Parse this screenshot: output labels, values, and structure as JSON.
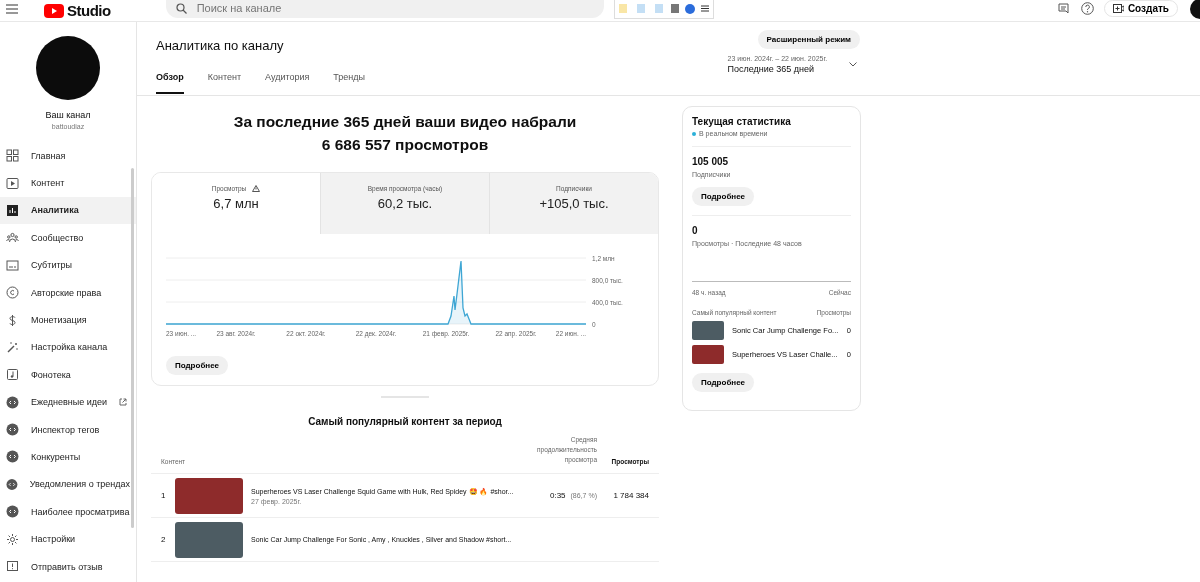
{
  "header": {
    "logo_text": "Studio",
    "search": {
      "placeholder": "Поиск на канале"
    },
    "create_button": "Создать"
  },
  "sidebar": {
    "channel_label": "Ваш канал",
    "channel_handle": "battoudiaz",
    "items": [
      {
        "label": "Главная",
        "selected": false,
        "external": false
      },
      {
        "label": "Контент",
        "selected": false,
        "external": false
      },
      {
        "label": "Аналитика",
        "selected": true,
        "external": false
      },
      {
        "label": "Сообщество",
        "selected": false,
        "external": false
      },
      {
        "label": "Субтитры",
        "selected": false,
        "external": false
      },
      {
        "label": "Авторские права",
        "selected": false,
        "external": false
      },
      {
        "label": "Монетизация",
        "selected": false,
        "external": false
      },
      {
        "label": "Настройка канала",
        "selected": false,
        "external": false
      },
      {
        "label": "Фонотека",
        "selected": false,
        "external": false
      },
      {
        "label": "Ежедневные идеи",
        "selected": false,
        "external": true
      },
      {
        "label": "Инспектор тегов",
        "selected": false,
        "external": false
      },
      {
        "label": "Конкуренты",
        "selected": false,
        "external": false
      },
      {
        "label": "Уведомления о трендах",
        "selected": false,
        "external": false
      },
      {
        "label": "Наиболее просматрива",
        "selected": false,
        "external": false
      },
      {
        "label": "Настройки",
        "selected": false,
        "external": false
      },
      {
        "label": "Отправить отзыв",
        "selected": false,
        "external": false
      }
    ]
  },
  "page": {
    "title": "Аналитика по каналу",
    "tabs": [
      {
        "label": "Обзор",
        "selected": true
      },
      {
        "label": "Контент",
        "selected": false
      },
      {
        "label": "Аудитория",
        "selected": false
      },
      {
        "label": "Тренды",
        "selected": false
      }
    ],
    "advanced_button": "Расширенный режим",
    "date_range": {
      "dates": "23 июн. 2024г. – 22 июн. 2025г.",
      "period": "Последние 365 дней"
    }
  },
  "summary": {
    "line1": "За последние 365 дней ваши видео набрали",
    "line2": "6 686 557 просмотров"
  },
  "metrics": [
    {
      "label": "Просмотры",
      "value": "6,7 млн",
      "warning": true,
      "selected": true
    },
    {
      "label": "Время просмотра (часы)",
      "value": "60,2 тыс.",
      "warning": false,
      "selected": false
    },
    {
      "label": "Подписчики",
      "value": "+105,0 тыс.",
      "warning": false,
      "selected": false
    }
  ],
  "chart": {
    "x_labels": [
      "23 июн. ...",
      "23 авг. 2024г.",
      "22 окт. 2024г.",
      "22 дек. 2024г.",
      "21 февр. 2025г.",
      "22 апр. 2025г.",
      "22 июн. ..."
    ],
    "y_labels": [
      "1,2 млн",
      "800,0 тыс.",
      "400,0 тыс.",
      "0"
    ]
  },
  "details_button": "Подробнее",
  "top_content": {
    "title": "Самый популярный контент за период",
    "columns": [
      "Контент",
      "Средняя продолжительность просмотра",
      "Просмотры"
    ],
    "rows": [
      {
        "rank": "1",
        "title": "Superheroes VS Laser Challenge Squid Game with Hulk, Red Spidey 🤩 🔥 #shor...",
        "date": "27 февр. 2025г.",
        "duration": "0:35",
        "percent": "(86,7 %)",
        "views": "1 784 384",
        "color": "#8e2b2b"
      },
      {
        "rank": "2",
        "title": "Sonic Car Jump Challenge For Sonic , Amy , Knuckles , Silver and Shadow #short...",
        "color": "#4d5c63"
      }
    ]
  },
  "realtime": {
    "title": "Текущая статистика",
    "live_label": "В реальном времени",
    "subscribers": "105 005",
    "subscribers_label": "Подписчики",
    "details_button": "Подробнее",
    "views": "0",
    "views_label": "Просмотры · Последние 48 часов",
    "axis_start": "48 ч. назад",
    "axis_end": "Сейчас",
    "content_label": "Самый популярный контент",
    "content_views_label": "Просмотры",
    "items": [
      {
        "title": "Sonic Car Jump Challenge Fo...",
        "views": "0",
        "color": "#4d5c63"
      },
      {
        "title": "Superheroes VS Laser Challe...",
        "views": "0",
        "color": "#8e2b2b"
      }
    ],
    "details_button_2": "Подробнее"
  }
}
